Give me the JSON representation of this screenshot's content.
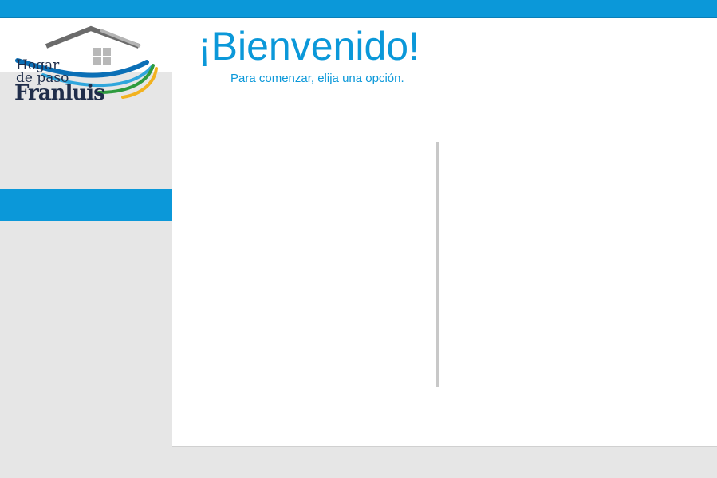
{
  "logo": {
    "line1": "Hogar",
    "line2": "de paso",
    "line3": "Franluis"
  },
  "welcome": {
    "title": "¡Bienvenido!",
    "subtitle": "Para comenzar, elija una opción."
  },
  "colors": {
    "accent": "#0b98d9",
    "sidebar": "#e6e6e6",
    "divider": "#c8c8c8",
    "logo_text": "#1f2d4a"
  }
}
